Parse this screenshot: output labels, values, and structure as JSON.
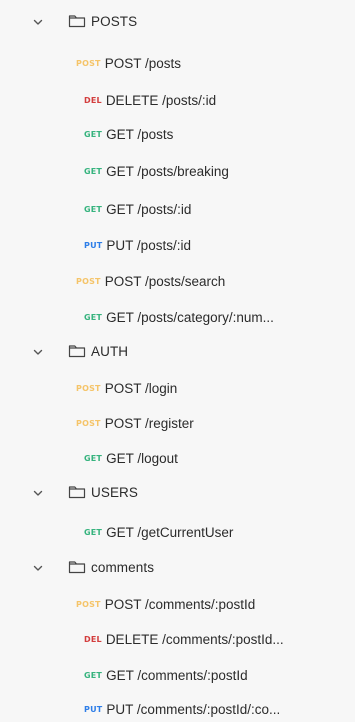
{
  "collection": {
    "folders": [
      {
        "name": "POSTS",
        "requests": [
          {
            "method": "POST",
            "label": "POST /posts"
          },
          {
            "method": "DEL",
            "label": "DELETE /posts/:id"
          },
          {
            "method": "GET",
            "label": "GET /posts"
          },
          {
            "method": "GET",
            "label": "GET /posts/breaking"
          },
          {
            "method": "GET",
            "label": "GET /posts/:id"
          },
          {
            "method": "PUT",
            "label": "PUT /posts/:id"
          },
          {
            "method": "POST",
            "label": "POST /posts/search"
          },
          {
            "method": "GET",
            "label": "GET /posts/category/:num..."
          }
        ]
      },
      {
        "name": "AUTH",
        "requests": [
          {
            "method": "POST",
            "label": "POST /login"
          },
          {
            "method": "POST",
            "label": "POST /register"
          },
          {
            "method": "GET",
            "label": "GET /logout"
          }
        ]
      },
      {
        "name": "USERS",
        "requests": [
          {
            "method": "GET",
            "label": "GET /getCurrentUser"
          }
        ]
      },
      {
        "name": "comments",
        "requests": [
          {
            "method": "POST",
            "label": "POST /comments/:postId"
          },
          {
            "method": "DEL",
            "label": "DELETE /comments/:postId..."
          },
          {
            "method": "GET",
            "label": "GET /comments/:postId"
          },
          {
            "method": "PUT",
            "label": "PUT /comments/:postId/:co..."
          }
        ]
      }
    ]
  },
  "method_colors": {
    "POST": "#f5c469",
    "GET": "#36b37e",
    "DEL": "#d33d3d",
    "PUT": "#2e7ee8"
  },
  "icons": {
    "chevron": "chevron-down-icon",
    "folder": "folder-icon"
  }
}
